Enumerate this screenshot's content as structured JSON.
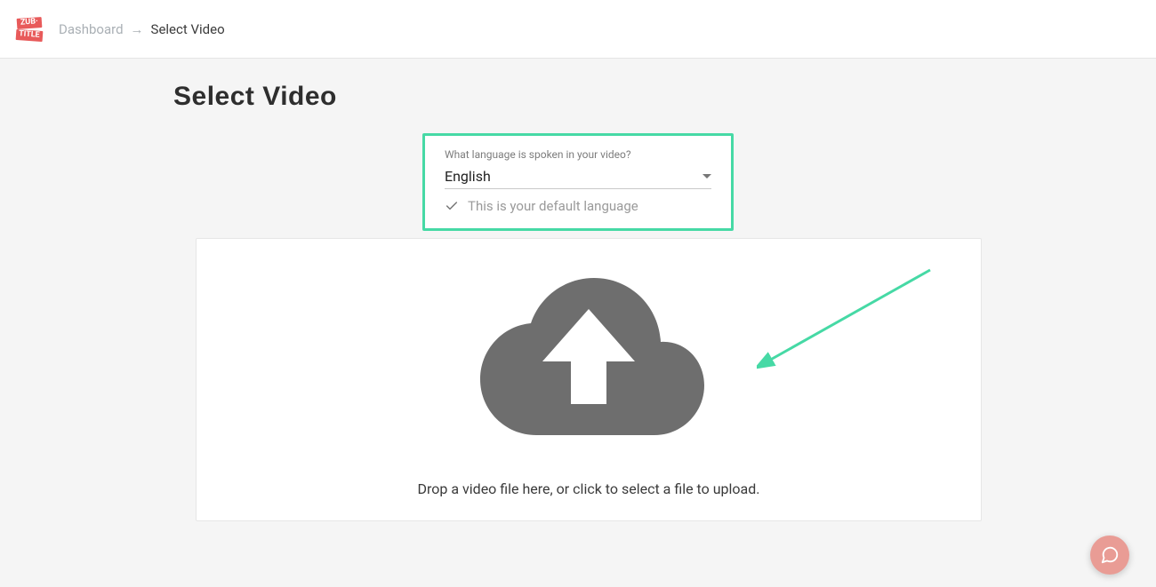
{
  "logo": {
    "line1": "ZUB·",
    "line2": "TITLE"
  },
  "breadcrumb": {
    "items": [
      {
        "label": "Dashboard",
        "active": false
      },
      {
        "label": "Select Video",
        "active": true
      }
    ],
    "separator": "→"
  },
  "page": {
    "title": "Select Video"
  },
  "language": {
    "label": "What language is spoken in your video?",
    "selected": "English",
    "note": "This is your default language"
  },
  "upload": {
    "instruction": "Drop a video file here, or click to select a file to upload."
  },
  "colors": {
    "highlight": "#46d9a5",
    "brand": "#e85a5a",
    "help": "#e99c95",
    "cloud": "#6e6e6e"
  }
}
